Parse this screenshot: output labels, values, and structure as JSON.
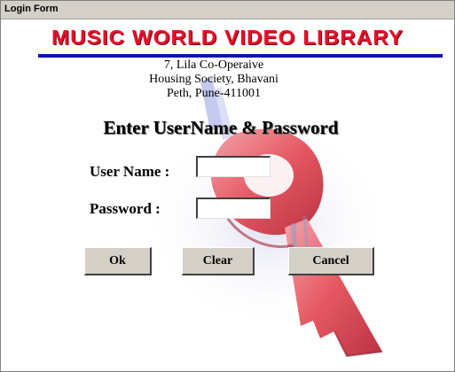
{
  "window": {
    "title": "Login Form"
  },
  "header": {
    "brand": "MUSIC WORLD VIDEO LIBRARY",
    "address_lines": [
      "7, Lila Co-Operaive",
      "Housing Society, Bhavani",
      "Peth, Pune-411001"
    ]
  },
  "form": {
    "heading": "Enter UserName & Password",
    "username_label": "User Name :",
    "username_value": "",
    "password_label": "Password :",
    "password_value": ""
  },
  "buttons": {
    "ok": "Ok",
    "clear": "Clear",
    "cancel": "Cancel"
  },
  "colors": {
    "brand": "#e8102a",
    "rule": "#1010b0",
    "key": "#e4505a"
  },
  "icons": {
    "background": "key-icon"
  }
}
